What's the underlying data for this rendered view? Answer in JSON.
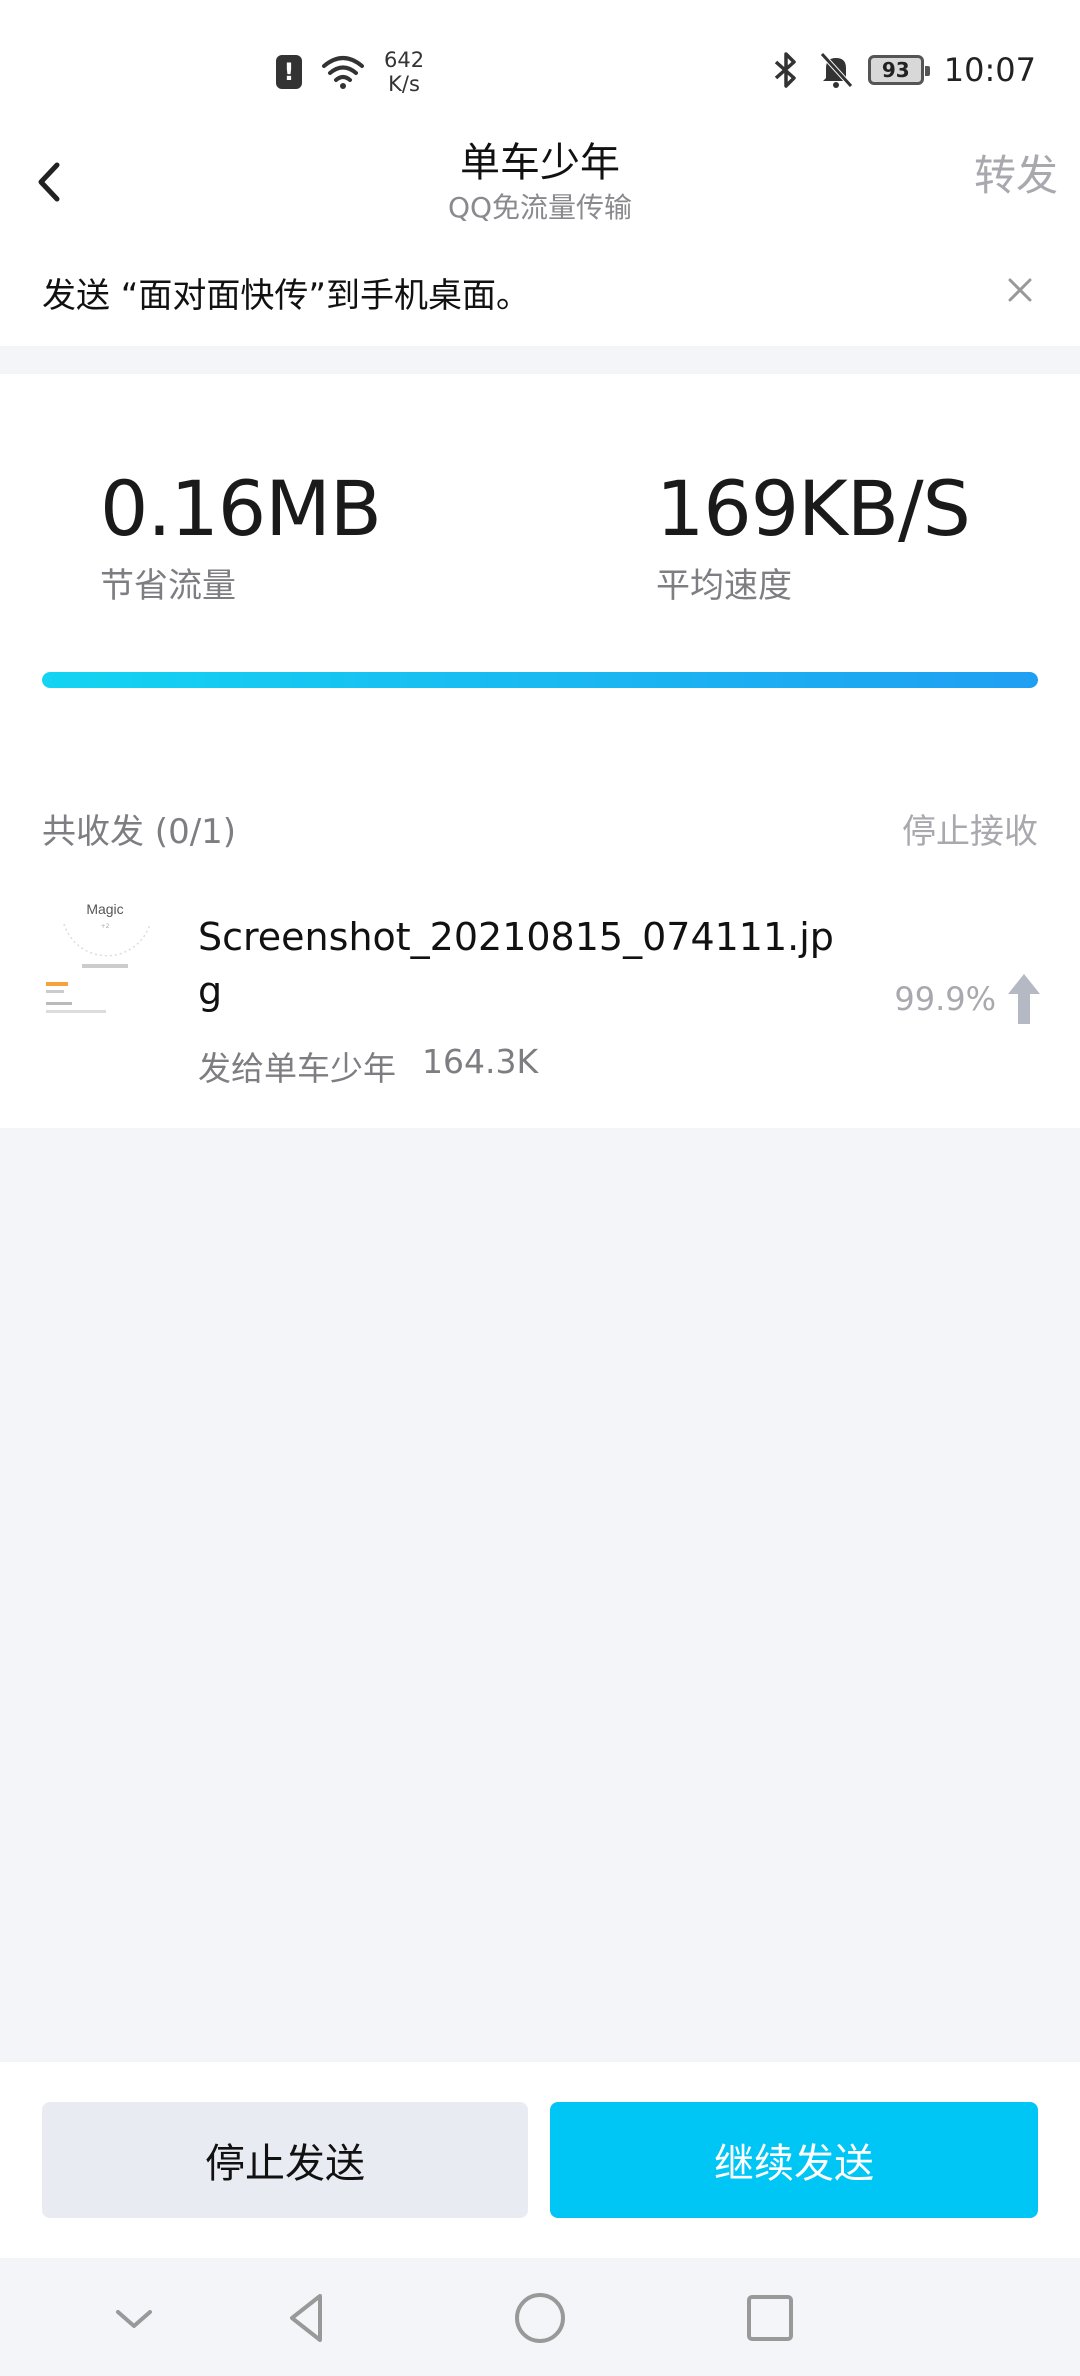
{
  "status_bar": {
    "net_speed_value": "642",
    "net_speed_unit": "K/s",
    "battery": "93",
    "time": "10:07",
    "icons": [
      "alert-icon",
      "wifi-icon",
      "bluetooth-icon",
      "bell-mute-icon",
      "battery-icon"
    ]
  },
  "header": {
    "title": "单车少年",
    "subtitle": "QQ免流量传输",
    "forward_label": "转发"
  },
  "tip": {
    "text": "发送 “面对面快传”到手机桌面。"
  },
  "stats": {
    "saved_value": "0.16MB",
    "saved_label": "节省流量",
    "speed_value": "169KB/S",
    "speed_label": "平均速度",
    "progress": 1.0
  },
  "transfer": {
    "section_title": "共收发 (0/1)",
    "stop_receive_label": "停止接收",
    "file": {
      "name": "Screenshot_20210815_074111.jpg",
      "recipient": "发给单车少年",
      "size": "164.3K",
      "percent": "99.9%",
      "thumbnail_text": "Magic"
    }
  },
  "actions": {
    "stop_label": "停止发送",
    "continue_label": "继续发送"
  },
  "colors": {
    "accent": "#00c6f5",
    "progress_start": "#13d4f2",
    "progress_end": "#1f9ff2"
  }
}
